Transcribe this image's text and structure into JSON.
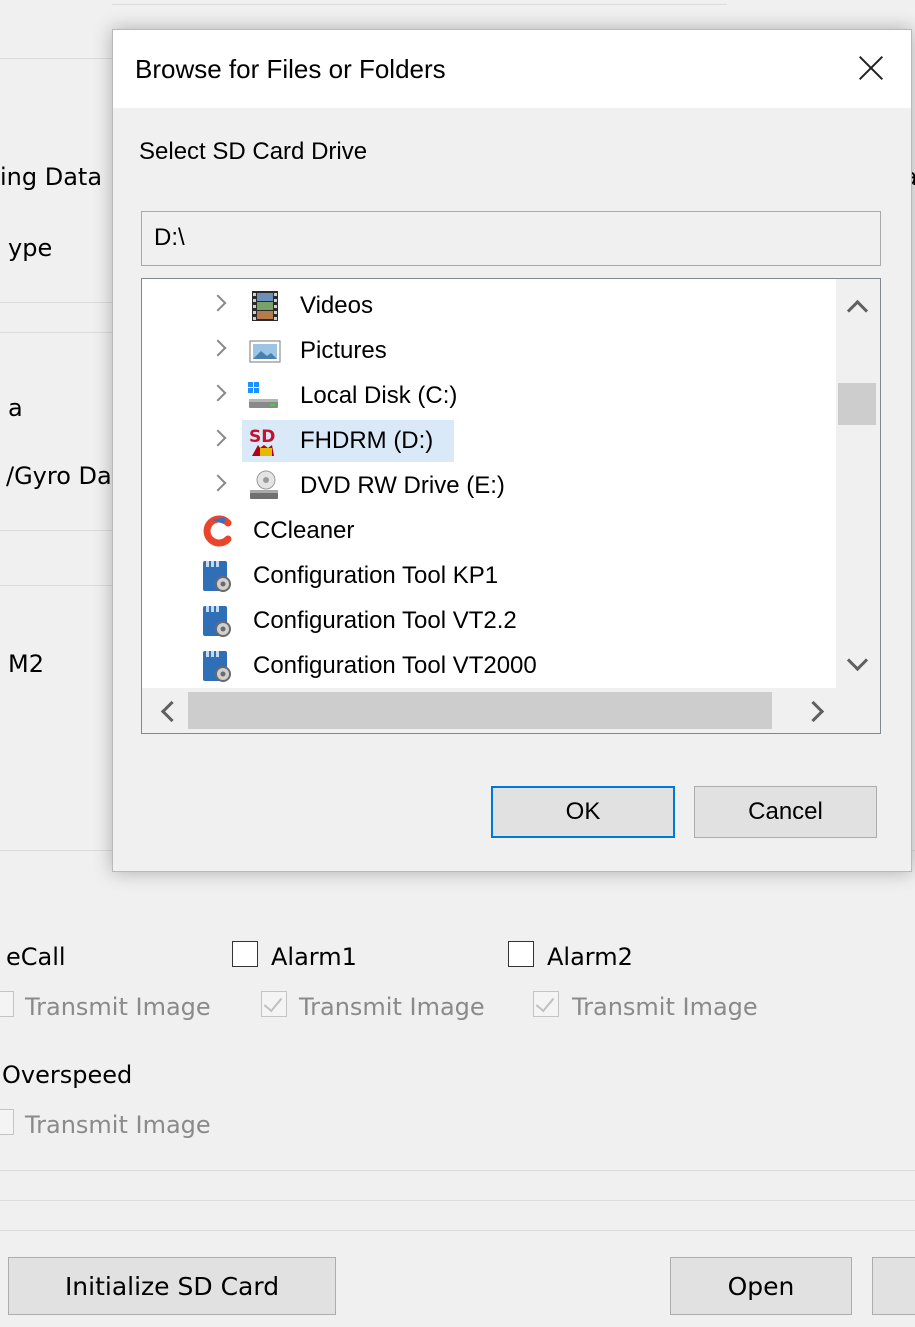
{
  "background": {
    "left_labels": [
      "ing Data",
      "ype",
      "a",
      "/Gyro Da",
      "M2"
    ],
    "right_fragment": "a",
    "events": [
      {
        "label": "eCall",
        "checked": false,
        "sub_label": "Transmit Image"
      },
      {
        "label": "Alarm1",
        "checked": false,
        "sub_label": "Transmit Image"
      },
      {
        "label": "Alarm2",
        "checked": false,
        "sub_label": "Transmit Image"
      }
    ],
    "overspeed": {
      "label": "Overspeed",
      "sub_label": "Transmit Image"
    },
    "buttons": {
      "initialize": "Initialize SD Card",
      "open": "Open"
    }
  },
  "dialog": {
    "title": "Browse for Files or Folders",
    "prompt": "Select SD Card Drive",
    "path": "D:\\",
    "tree": [
      {
        "label": "Videos",
        "icon": "videos-icon",
        "expandable": true,
        "selected": false
      },
      {
        "label": "Pictures",
        "icon": "pictures-icon",
        "expandable": true,
        "selected": false
      },
      {
        "label": "Local Disk (C:)",
        "icon": "local-disk-icon",
        "expandable": true,
        "selected": false
      },
      {
        "label": "FHDRM (D:)",
        "icon": "sd-card-icon",
        "expandable": true,
        "selected": true
      },
      {
        "label": "DVD RW Drive (E:)",
        "icon": "dvd-drive-icon",
        "expandable": true,
        "selected": false
      },
      {
        "label": "CCleaner",
        "icon": "ccleaner-icon",
        "expandable": false,
        "selected": false
      },
      {
        "label": "Configuration Tool KP1",
        "icon": "config-tool-icon",
        "expandable": false,
        "selected": false
      },
      {
        "label": "Configuration Tool VT2.2",
        "icon": "config-tool-icon",
        "expandable": false,
        "selected": false
      },
      {
        "label": "Configuration Tool VT2000",
        "icon": "config-tool-icon",
        "expandable": false,
        "selected": false
      }
    ],
    "ok_label": "OK",
    "cancel_label": "Cancel",
    "colors": {
      "selection": "#d9e9f8",
      "default_button_border": "#0078d7"
    }
  }
}
